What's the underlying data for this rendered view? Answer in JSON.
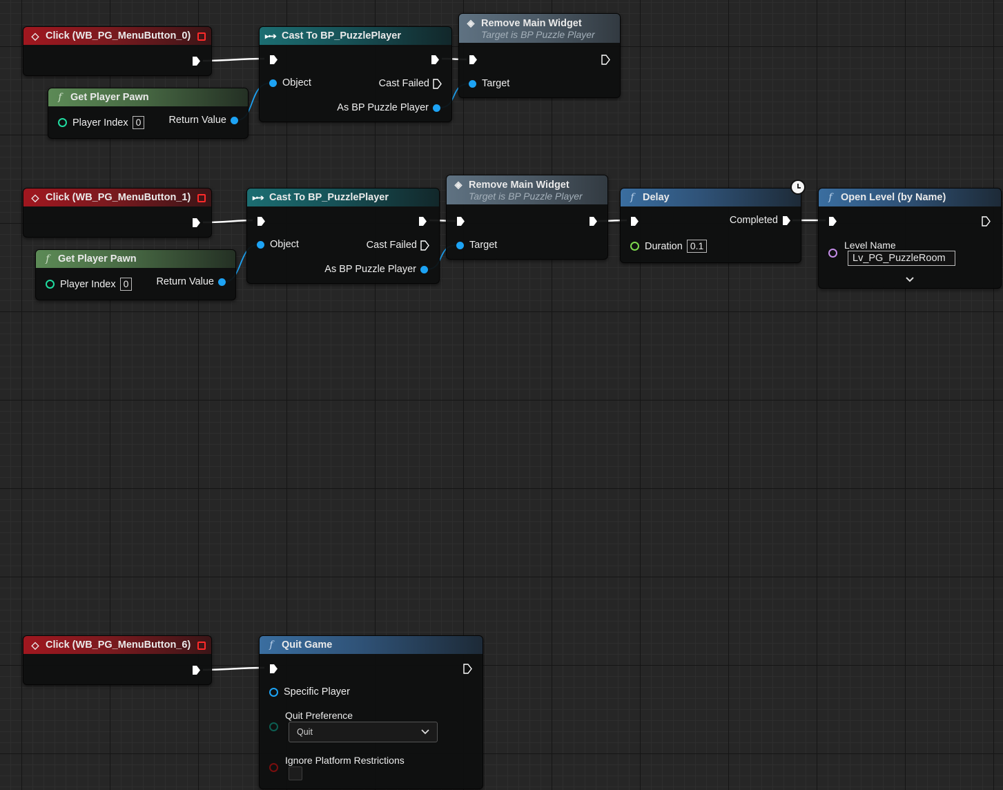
{
  "colors": {
    "exec_wire": "#ffffff",
    "object_pin": "#1da3f4",
    "int_pin": "#20dca0",
    "float_pin": "#8de05a",
    "name_pin": "#c58de8",
    "bool_pin": "#8a0f0f"
  },
  "group1": {
    "event": {
      "title": "Click (WB_PG_MenuButton_0)",
      "icon": "event-diamond-icon"
    },
    "pawn": {
      "title": "Get Player Pawn",
      "player_index_label": "Player Index",
      "player_index_value": "0",
      "return_label": "Return Value"
    },
    "cast": {
      "title": "Cast To BP_PuzzlePlayer",
      "object_label": "Object",
      "cast_failed_label": "Cast Failed",
      "as_label": "As BP Puzzle Player"
    },
    "remove": {
      "title": "Remove Main Widget",
      "subtitle": "Target is BP Puzzle Player",
      "target_label": "Target"
    }
  },
  "group2": {
    "event": {
      "title": "Click (WB_PG_MenuButton_1)",
      "icon": "event-diamond-icon"
    },
    "pawn": {
      "title": "Get Player Pawn",
      "player_index_label": "Player Index",
      "player_index_value": "0",
      "return_label": "Return Value"
    },
    "cast": {
      "title": "Cast To BP_PuzzlePlayer",
      "object_label": "Object",
      "cast_failed_label": "Cast Failed",
      "as_label": "As BP Puzzle Player"
    },
    "remove": {
      "title": "Remove Main Widget",
      "subtitle": "Target is BP Puzzle Player",
      "target_label": "Target"
    },
    "delay": {
      "title": "Delay",
      "completed_label": "Completed",
      "duration_label": "Duration",
      "duration_value": "0.1"
    },
    "open_level": {
      "title": "Open Level (by Name)",
      "level_name_label": "Level Name",
      "level_name_value": "Lv_PG_PuzzleRoom"
    }
  },
  "group3": {
    "event": {
      "title": "Click (WB_PG_MenuButton_6)",
      "icon": "event-diamond-icon"
    },
    "quit": {
      "title": "Quit Game",
      "specific_player_label": "Specific Player",
      "quit_pref_label": "Quit Preference",
      "quit_pref_value": "Quit",
      "ignore_label": "Ignore Platform Restrictions"
    }
  }
}
